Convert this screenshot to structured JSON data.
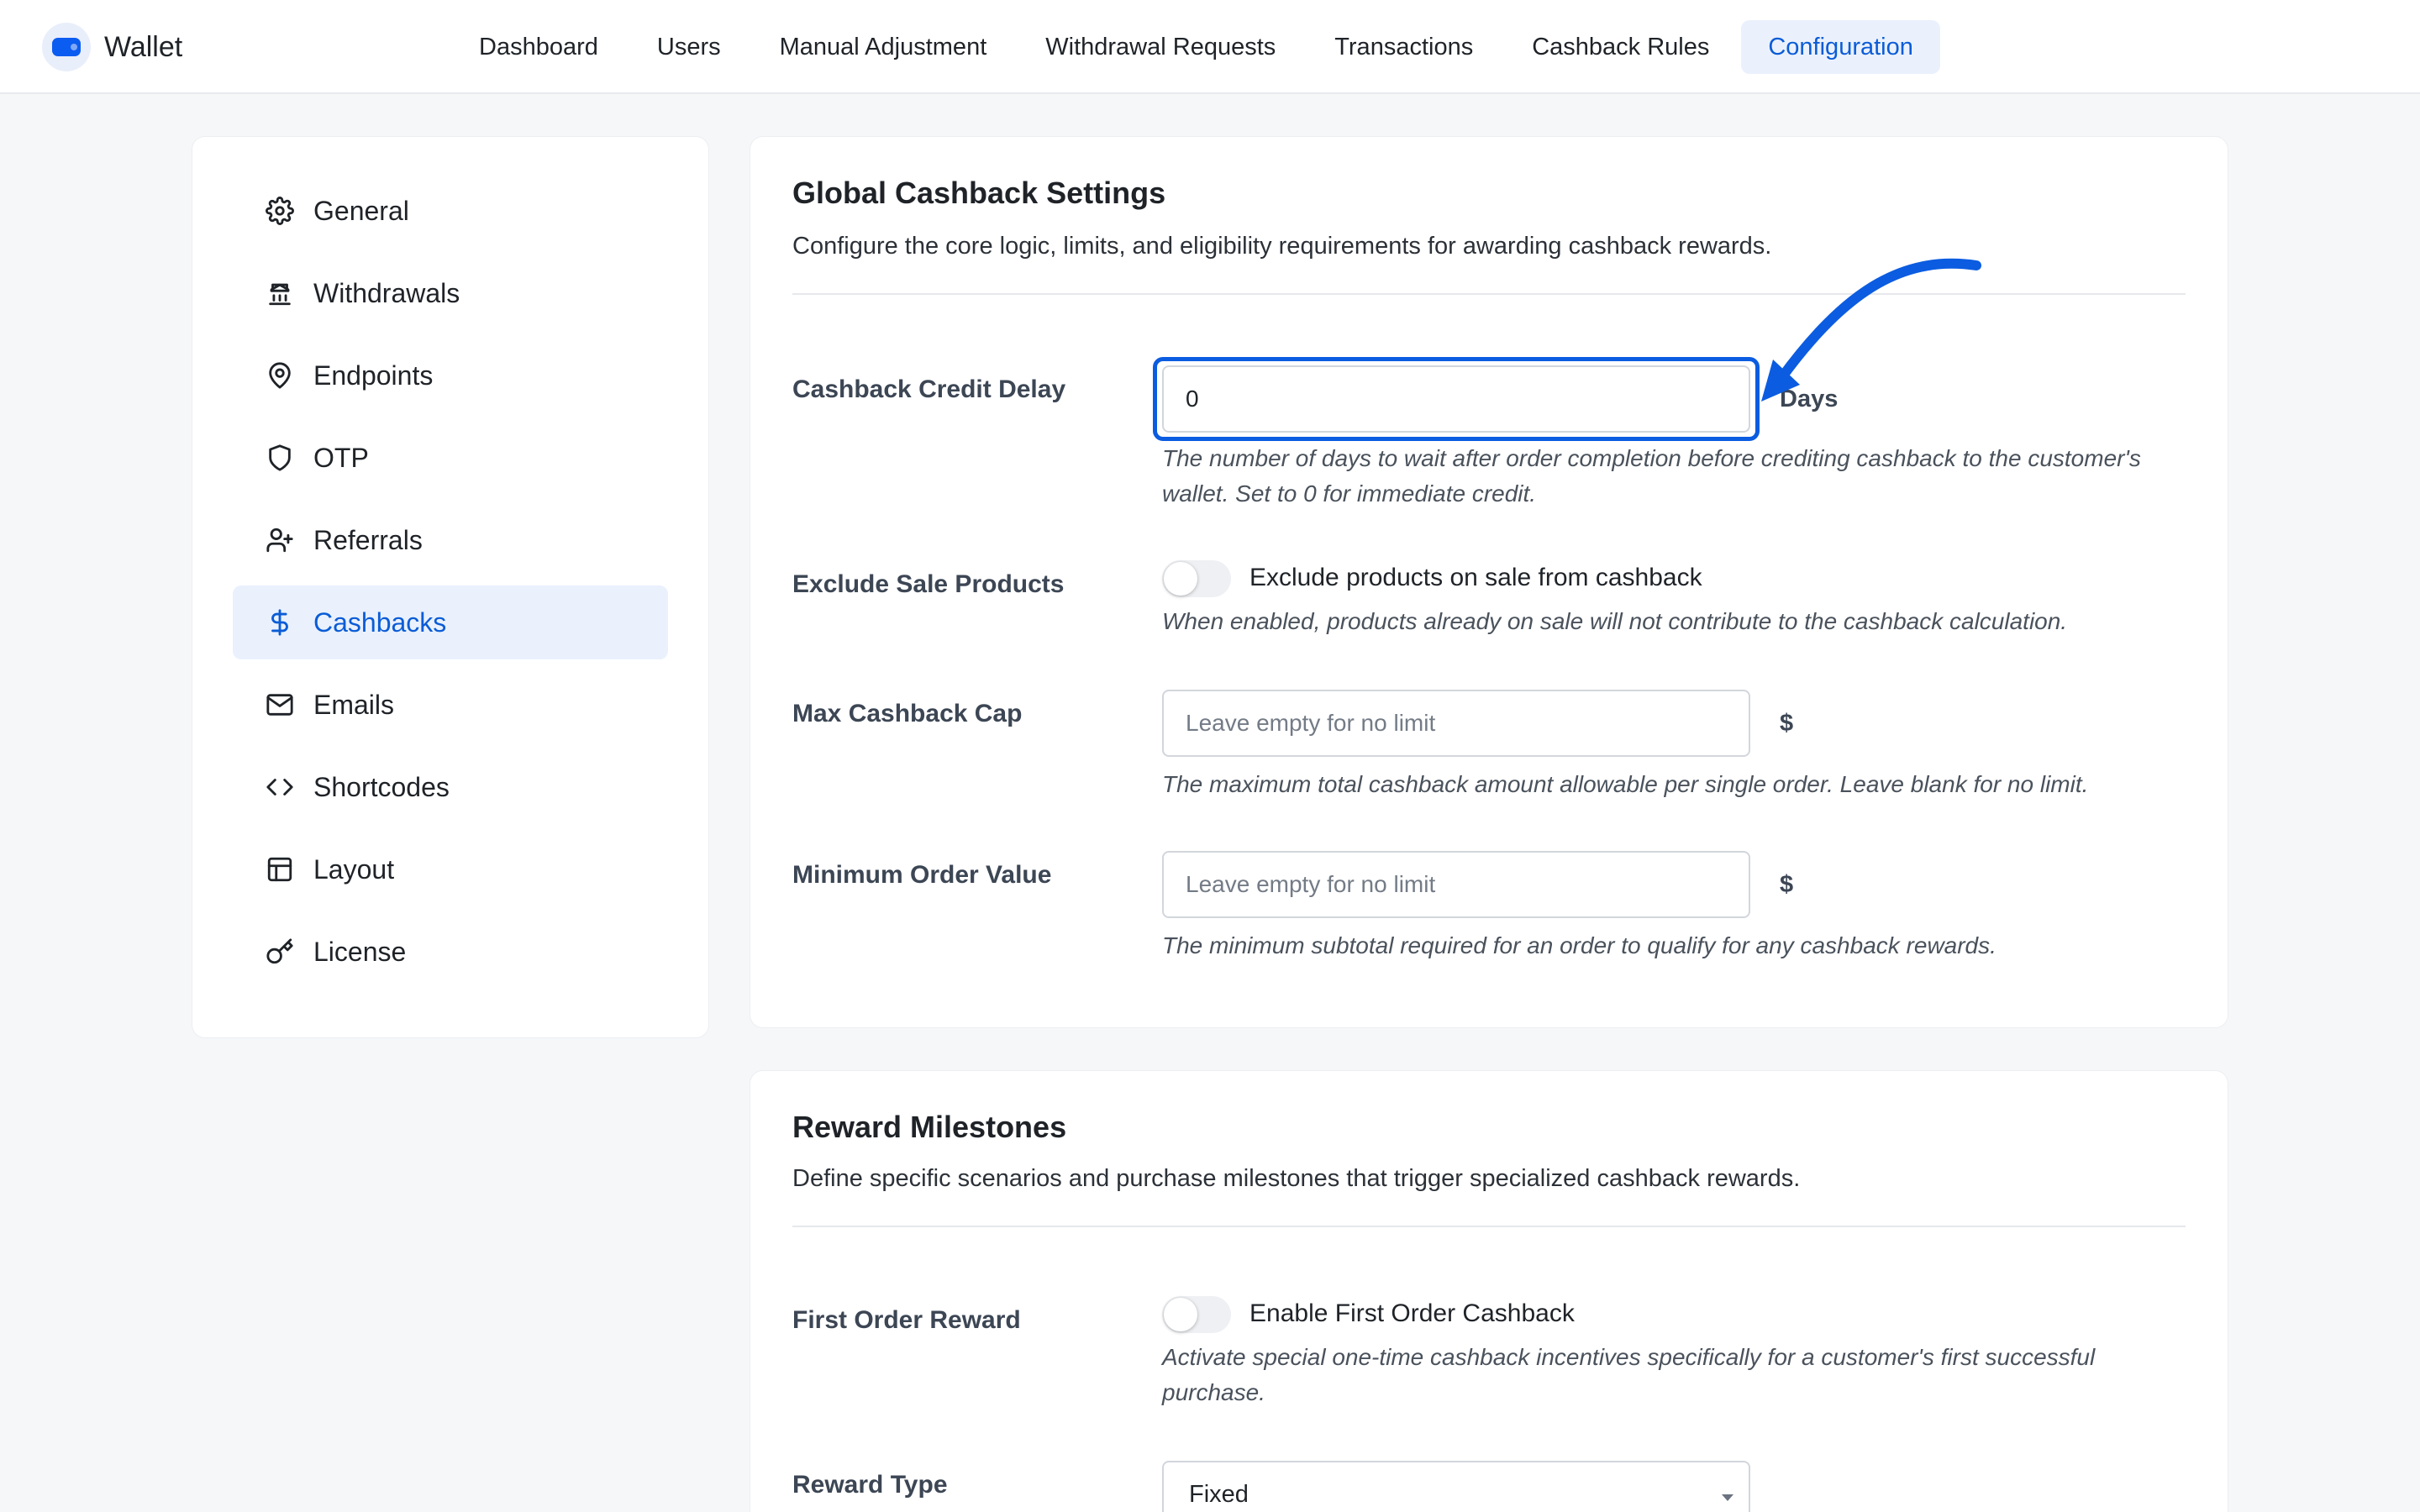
{
  "app": {
    "title": "Wallet"
  },
  "nav": [
    {
      "label": "Dashboard"
    },
    {
      "label": "Users"
    },
    {
      "label": "Manual Adjustment"
    },
    {
      "label": "Withdrawal Requests"
    },
    {
      "label": "Transactions"
    },
    {
      "label": "Cashback Rules"
    },
    {
      "label": "Configuration",
      "active": true
    }
  ],
  "sidebar": {
    "items": [
      {
        "label": "General",
        "icon": "gear-icon"
      },
      {
        "label": "Withdrawals",
        "icon": "bank-icon"
      },
      {
        "label": "Endpoints",
        "icon": "map-pin-icon"
      },
      {
        "label": "OTP",
        "icon": "shield-icon"
      },
      {
        "label": "Referrals",
        "icon": "user-plus-icon"
      },
      {
        "label": "Cashbacks",
        "icon": "dollar-icon",
        "active": true
      },
      {
        "label": "Emails",
        "icon": "mail-icon"
      },
      {
        "label": "Shortcodes",
        "icon": "code-icon"
      },
      {
        "label": "Layout",
        "icon": "layout-icon"
      },
      {
        "label": "License",
        "icon": "key-icon"
      }
    ]
  },
  "global": {
    "title": "Global Cashback Settings",
    "description": "Configure the core logic, limits, and eligibility requirements for awarding cashback rewards.",
    "credit_delay": {
      "label": "Cashback Credit Delay",
      "value": "0",
      "suffix": "Days",
      "help": "The number of days to wait after order completion before crediting cashback to the customer's wallet. Set to 0 for immediate credit."
    },
    "exclude_sale": {
      "label": "Exclude Sale Products",
      "toggle_label": "Exclude products on sale from cashback",
      "enabled": false,
      "help": "When enabled, products already on sale will not contribute to the cashback calculation."
    },
    "max_cap": {
      "label": "Max Cashback Cap",
      "placeholder": "Leave empty for no limit",
      "value": "",
      "suffix": "$",
      "help": "The maximum total cashback amount allowable per single order. Leave blank for no limit."
    },
    "min_order": {
      "label": "Minimum Order Value",
      "placeholder": "Leave empty for no limit",
      "value": "",
      "suffix": "$",
      "help": "The minimum subtotal required for an order to qualify for any cashback rewards."
    }
  },
  "milestones": {
    "title": "Reward Milestones",
    "description": "Define specific scenarios and purchase milestones that trigger specialized cashback rewards.",
    "first_order": {
      "label": "First Order Reward",
      "toggle_label": "Enable First Order Cashback",
      "enabled": false,
      "help": "Activate special one-time cashback incentives specifically for a customer's first successful purchase."
    },
    "reward_type": {
      "label": "Reward Type",
      "value": "Fixed"
    }
  },
  "colors": {
    "accent": "#0b5cd6",
    "annotation": "#0b5ce0"
  }
}
